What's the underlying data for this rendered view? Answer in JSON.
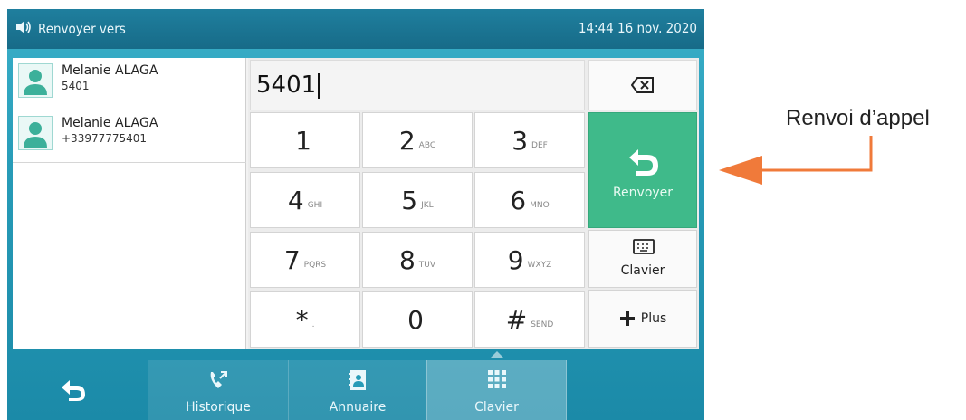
{
  "statusbar": {
    "title": "Renvoyer vers",
    "time": "14:44",
    "date": "16 nov. 2020",
    "speaker_icon": "speaker-icon"
  },
  "contacts": [
    {
      "name": "Melanie ALAGA",
      "number": "5401"
    },
    {
      "name": "Melanie ALAGA",
      "number": "+33977775401"
    }
  ],
  "dialer": {
    "value": "5401",
    "keys": [
      {
        "digit": "1",
        "sub": ""
      },
      {
        "digit": "2",
        "sub": "ABC"
      },
      {
        "digit": "3",
        "sub": "DEF"
      },
      {
        "digit": "4",
        "sub": "GHI"
      },
      {
        "digit": "5",
        "sub": "JKL"
      },
      {
        "digit": "6",
        "sub": "MNO"
      },
      {
        "digit": "7",
        "sub": "PQRS"
      },
      {
        "digit": "8",
        "sub": "TUV"
      },
      {
        "digit": "9",
        "sub": "WXYZ"
      },
      {
        "digit": "*",
        "sub": "."
      },
      {
        "digit": "0",
        "sub": ""
      },
      {
        "digit": "#",
        "sub": "SEND"
      }
    ],
    "forward_label": "Renvoyer",
    "keyboard_label": "Clavier",
    "more_label": "Plus"
  },
  "bottombar": {
    "tabs": [
      {
        "label": "Historique",
        "icon": "call-history-icon"
      },
      {
        "label": "Annuaire",
        "icon": "directory-icon"
      },
      {
        "label": "Clavier",
        "icon": "keypad-icon"
      }
    ],
    "active_tab": "Clavier"
  },
  "annotation": {
    "label": "Renvoi d’appel",
    "arrow_color": "#f07a3a"
  },
  "colors": {
    "accent_green": "#3fba8a",
    "status_blue": "#1f7f9e",
    "screen_teal": "#279bb7"
  }
}
